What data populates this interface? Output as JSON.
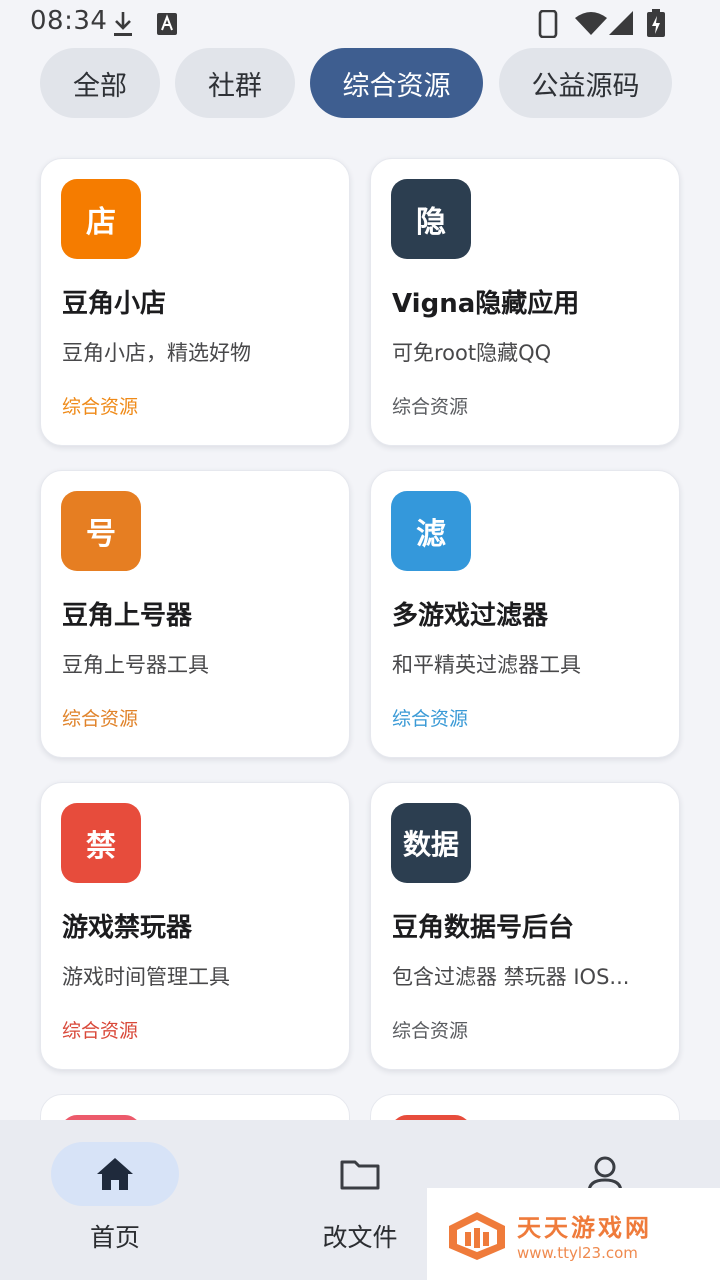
{
  "status_bar": {
    "time": "08:34"
  },
  "chips": [
    {
      "label": "全部",
      "active": false
    },
    {
      "label": "社群",
      "active": false
    },
    {
      "label": "综合资源",
      "active": true
    },
    {
      "label": "公益源码",
      "active": false
    }
  ],
  "cards": [
    {
      "icon_text": "店",
      "icon_color": "#f57c00",
      "title": "豆角小店",
      "desc": "豆角小店，精选好物",
      "tag": "综合资源",
      "tag_color": "#ef8a18"
    },
    {
      "icon_text": "隐",
      "icon_color": "#2c3e50",
      "title": "Vigna隐藏应用",
      "desc": "可免root隐藏QQ",
      "tag": "综合资源",
      "tag_color": "#5a5c60"
    },
    {
      "icon_text": "号",
      "icon_color": "#e67e22",
      "title": "豆角上号器",
      "desc": "豆角上号器工具",
      "tag": "综合资源",
      "tag_color": "#e0832a"
    },
    {
      "icon_text": "滤",
      "icon_color": "#3498db",
      "title": "多游戏过滤器",
      "desc": "和平精英过滤器工具",
      "tag": "综合资源",
      "tag_color": "#3a9ad6"
    },
    {
      "icon_text": "禁",
      "icon_color": "#e74c3c",
      "title": "游戏禁玩器",
      "desc": "游戏时间管理工具",
      "tag": "综合资源",
      "tag_color": "#d9493a"
    },
    {
      "icon_text": "数据",
      "icon_color": "#2c3e50",
      "title": "豆角数据号后台",
      "desc": "包含过滤器 禁玩器  IOS...",
      "tag": "综合资源",
      "tag_color": "#5a5c60"
    }
  ],
  "peek_colors": [
    "#ec5a6b",
    "#e74c3c"
  ],
  "bottom_nav": {
    "items": [
      {
        "label": "首页",
        "icon": "home-icon",
        "active": true
      },
      {
        "label": "改文件",
        "icon": "folder-icon",
        "active": false
      },
      {
        "label": "我的",
        "icon": "person-icon",
        "active": false
      }
    ]
  },
  "watermark": {
    "text": "天天游戏网",
    "url": "www.ttyl23.com"
  }
}
